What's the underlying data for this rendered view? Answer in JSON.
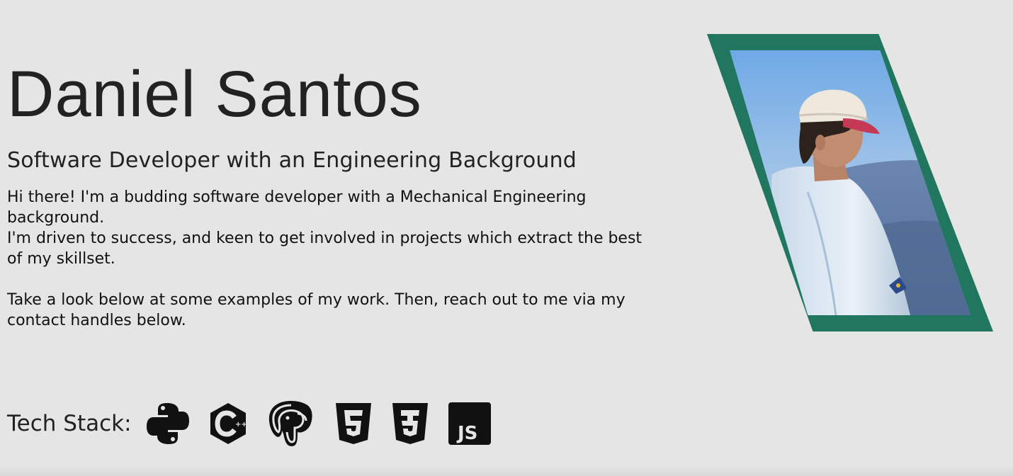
{
  "hero": {
    "name": "Daniel Santos",
    "subtitle": "Software Developer with an Engineering Background",
    "bio_line_1": "Hi there! I'm a budding software developer with a Mechanical Engineering background.",
    "bio_line_2": "I'm driven to success, and keen to get involved in projects which extract the best of my skillset.",
    "bio_line_3": "Take a look below at some examples of my work. Then, reach out to me via my contact handles below."
  },
  "photo": {
    "frame_color": "#217660"
  },
  "tech_stack": {
    "label": "Tech Stack:",
    "icons": [
      "python-icon",
      "cplusplus-icon",
      "postgresql-icon",
      "html5-icon",
      "css3-icon",
      "javascript-icon"
    ],
    "js_text": "JS",
    "cpp_text": "++"
  },
  "colors": {
    "background": "#e5e5e5",
    "text": "#222222",
    "accent": "#217660"
  }
}
